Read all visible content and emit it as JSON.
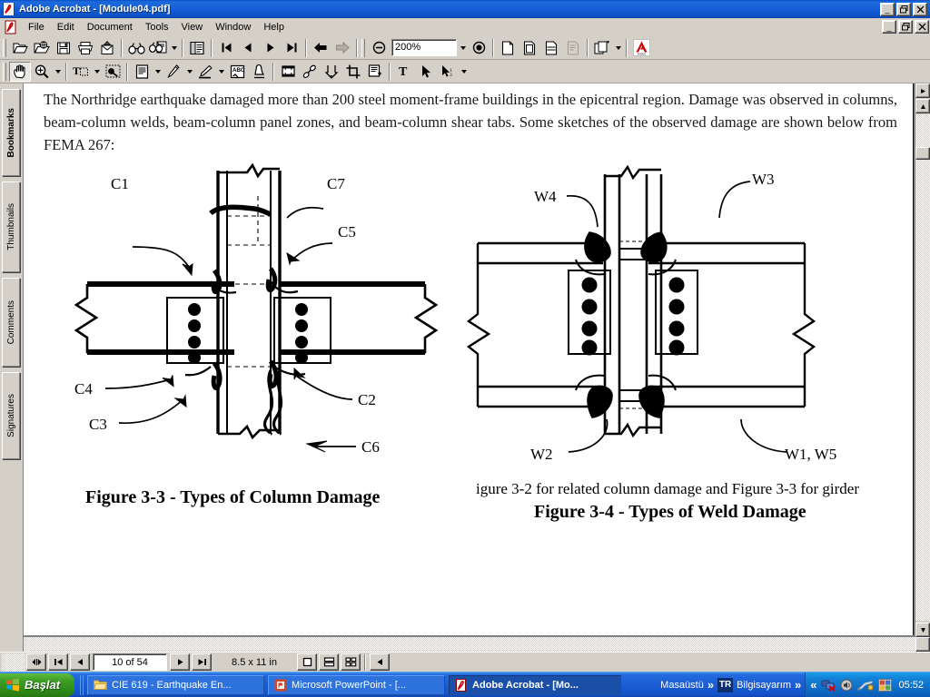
{
  "window": {
    "title": "Adobe Acrobat - [Module04.pdf]",
    "app_icon": "acrobat-icon",
    "minimize_label": "_",
    "maximize_label": "□",
    "close_label": "✕"
  },
  "menu": {
    "items": [
      {
        "label": "File",
        "name": "menu-file"
      },
      {
        "label": "Edit",
        "name": "menu-edit"
      },
      {
        "label": "Document",
        "name": "menu-document"
      },
      {
        "label": "Tools",
        "name": "menu-tools"
      },
      {
        "label": "View",
        "name": "menu-view"
      },
      {
        "label": "Window",
        "name": "menu-window"
      },
      {
        "label": "Help",
        "name": "menu-help"
      }
    ]
  },
  "toolbar_primary": {
    "buttons": [
      {
        "name": "open-file-icon",
        "title": "Open"
      },
      {
        "name": "open-web-page-icon",
        "title": "Open Web Page"
      },
      {
        "name": "save-icon",
        "title": "Save"
      },
      {
        "name": "print-icon",
        "title": "Print"
      },
      {
        "name": "email-icon",
        "title": "Email"
      },
      {
        "name": "find-icon",
        "title": "Find"
      },
      {
        "name": "search-index-icon",
        "title": "Search"
      },
      {
        "name": "show-hide-navigation-pane-icon",
        "title": "Show/Hide Navigation Pane"
      },
      {
        "name": "first-page-icon",
        "title": "First Page"
      },
      {
        "name": "previous-page-icon",
        "title": "Previous Page"
      },
      {
        "name": "next-page-icon",
        "title": "Next Page"
      },
      {
        "name": "last-page-icon",
        "title": "Last Page"
      },
      {
        "name": "go-back-icon",
        "title": "Go to Previous View"
      },
      {
        "name": "go-forward-icon",
        "title": "Go to Next View"
      },
      {
        "name": "zoom-out-icon",
        "title": "Zoom Out"
      },
      {
        "name": "zoom-in-icon",
        "title": "Zoom In"
      },
      {
        "name": "actual-size-icon",
        "title": "Actual Size"
      },
      {
        "name": "fit-page-icon",
        "title": "Fit in Window"
      },
      {
        "name": "fit-width-icon",
        "title": "Fit Width"
      },
      {
        "name": "reflow-icon",
        "title": "Reflow"
      },
      {
        "name": "acrobat-online-icon",
        "title": "Acrobat Online"
      }
    ],
    "zoom_value": "200%",
    "zoom_placeholder": "200%"
  },
  "toolbar_secondary": {
    "buttons": [
      {
        "name": "hand-tool-icon",
        "title": "Hand Tool"
      },
      {
        "name": "zoom-tool-icon",
        "title": "Zoom In Tool"
      },
      {
        "name": "text-select-tool-icon",
        "title": "Text Select Tool"
      },
      {
        "name": "graphics-select-tool-icon",
        "title": "Graphics Select Tool"
      },
      {
        "name": "note-tool-icon",
        "title": "Note Tool"
      },
      {
        "name": "pencil-tool-icon",
        "title": "Pencil Tool"
      },
      {
        "name": "highlight-tool-icon",
        "title": "Highlight Tool"
      },
      {
        "name": "spell-check-icon",
        "title": "Spell Check"
      },
      {
        "name": "stamp-tool-icon",
        "title": "Stamp Tool"
      },
      {
        "name": "movie-tool-icon",
        "title": "Movie Tool"
      },
      {
        "name": "link-tool-icon",
        "title": "Link Tool"
      },
      {
        "name": "article-tool-icon",
        "title": "Article Tool"
      },
      {
        "name": "crop-tool-icon",
        "title": "Crop Tool"
      },
      {
        "name": "form-tool-icon",
        "title": "Form Tool"
      },
      {
        "name": "text-field-tool-icon",
        "title": "Text Field"
      },
      {
        "name": "pointer-tool-icon",
        "title": "Pointer"
      },
      {
        "name": "digital-signature-tool-icon",
        "title": "Digital Signature"
      }
    ]
  },
  "navigation_pane": {
    "tabs": [
      {
        "label": "Bookmarks",
        "name": "nav-tab-bookmarks",
        "active": true
      },
      {
        "label": "Thumbnails",
        "name": "nav-tab-thumbnails",
        "active": false
      },
      {
        "label": "Comments",
        "name": "nav-tab-comments",
        "active": false
      },
      {
        "label": "Signatures",
        "name": "nav-tab-signatures",
        "active": false
      }
    ]
  },
  "document": {
    "paragraph": "The Northridge earthquake damaged more than 200 steel moment-frame buildings in the epicentral region. Damage was observed in columns, beam-column welds, beam-column panel zones, and beam-column shear tabs. Some sketches of the observed damage are shown below from FEMA 267:",
    "figure_left": {
      "caption": "Figure 3-3 - Types of Column Damage",
      "labels": [
        {
          "text": "C7",
          "name": "figure-label-c7"
        },
        {
          "text": "C1",
          "name": "figure-label-c1"
        },
        {
          "text": "C5",
          "name": "figure-label-c5"
        },
        {
          "text": "C4",
          "name": "figure-label-c4"
        },
        {
          "text": "C3",
          "name": "figure-label-c3"
        },
        {
          "text": "C2",
          "name": "figure-label-c2"
        },
        {
          "text": "C6",
          "name": "figure-label-c6"
        }
      ]
    },
    "figure_right": {
      "note": "igure 3-2 for related column damage and Figure 3-3 for girder",
      "caption": "Figure 3-4 - Types of Weld Damage",
      "labels": [
        {
          "text": "W4",
          "name": "figure-label-w4"
        },
        {
          "text": "W3",
          "name": "figure-label-w3"
        },
        {
          "text": "W2",
          "name": "figure-label-w2"
        },
        {
          "text": "W1, W5",
          "name": "figure-label-w1-w5"
        }
      ]
    }
  },
  "status_bar": {
    "page_indicator": "10 of 54",
    "page_size": "8.5 x 11 in",
    "buttons": [
      {
        "name": "first-page-status-icon"
      },
      {
        "name": "previous-page-status-icon"
      },
      {
        "name": "next-page-status-icon"
      },
      {
        "name": "last-page-status-icon"
      },
      {
        "name": "single-page-layout-icon"
      },
      {
        "name": "continuous-layout-icon"
      },
      {
        "name": "continuous-facing-layout-icon"
      },
      {
        "name": "collapse-status-icon"
      }
    ]
  },
  "taskbar": {
    "start_label": "Başlat",
    "items": [
      {
        "label": "CIE 619 - Earthquake En...",
        "icon": "folder-icon",
        "active": false,
        "name": "taskbar-item-explorer"
      },
      {
        "label": "Microsoft PowerPoint - [...",
        "icon": "powerpoint-icon",
        "active": false,
        "name": "taskbar-item-powerpoint"
      },
      {
        "label": "Adobe Acrobat - [Mo...",
        "icon": "acrobat-icon",
        "active": true,
        "name": "taskbar-item-acrobat"
      }
    ],
    "deskbands": [
      {
        "label": "Masaüstü",
        "name": "deskband-desktop"
      },
      {
        "label": "Bilgisayarım",
        "name": "deskband-my-computer"
      }
    ],
    "chevron": "»",
    "tray_chevron": "«",
    "language_indicator": "TR",
    "clock": "05:52",
    "tray_icons": [
      {
        "name": "network-disconnected-tray-icon"
      },
      {
        "name": "volume-tray-icon"
      },
      {
        "name": "usb-device-tray-icon"
      },
      {
        "name": "display-settings-tray-icon"
      }
    ]
  },
  "colors": {
    "title_blue": "#1560d8",
    "chrome_gray": "#d4d0c8",
    "taskbar_blue": "#1c5fd6",
    "start_green": "#3f9e25",
    "accent_red": "#cc0000"
  }
}
